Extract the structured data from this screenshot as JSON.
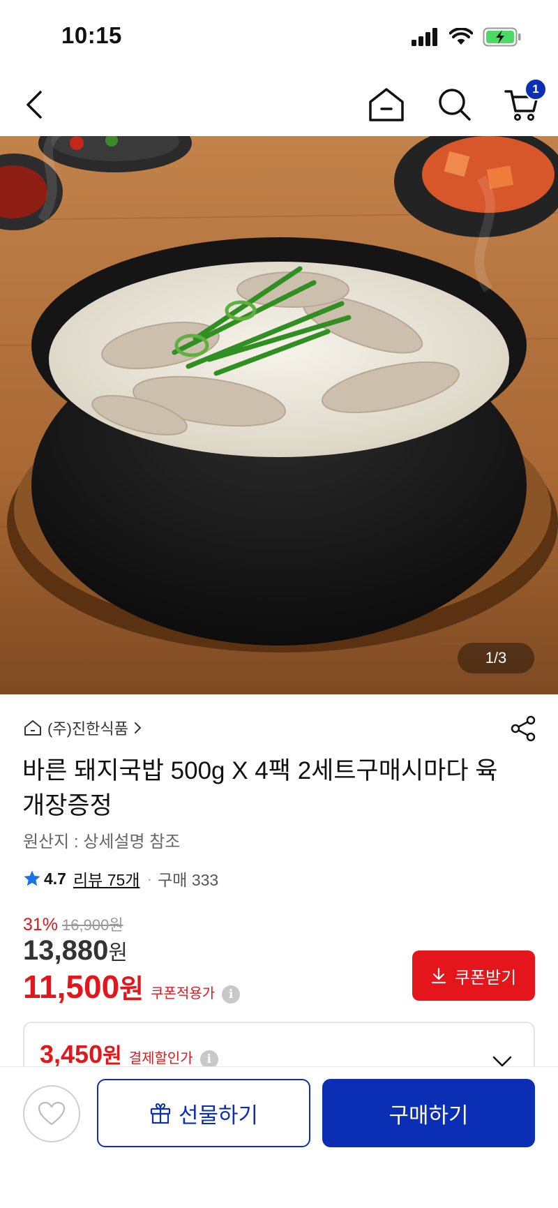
{
  "status": {
    "time": "10:15",
    "cart_count": "1"
  },
  "hero": {
    "counter": "1/3"
  },
  "store": {
    "name": "(주)진한식품"
  },
  "product": {
    "title": "바른 돼지국밥 500g X 4팩 2세트구매시마다 육개장증정",
    "origin": "원산지 : 상세설명 참조",
    "rating": "4.7",
    "reviews": "리뷰 75개",
    "purchases": "구매 333"
  },
  "price": {
    "discount_rate": "31%",
    "original": "16,900원",
    "sale": "13,880",
    "sale_unit": "원",
    "coupon_price": "11,500",
    "coupon_unit": "원",
    "coupon_label": "쿠폰적용가",
    "coupon_button": "쿠폰받기",
    "pay_price": "3,450",
    "pay_unit": "원",
    "pay_label": "결제할인가"
  },
  "bottom": {
    "gift": "선물하기",
    "buy": "구매하기"
  },
  "colors": {
    "brand": "#0a2fb5",
    "sale": "#e4161b"
  }
}
